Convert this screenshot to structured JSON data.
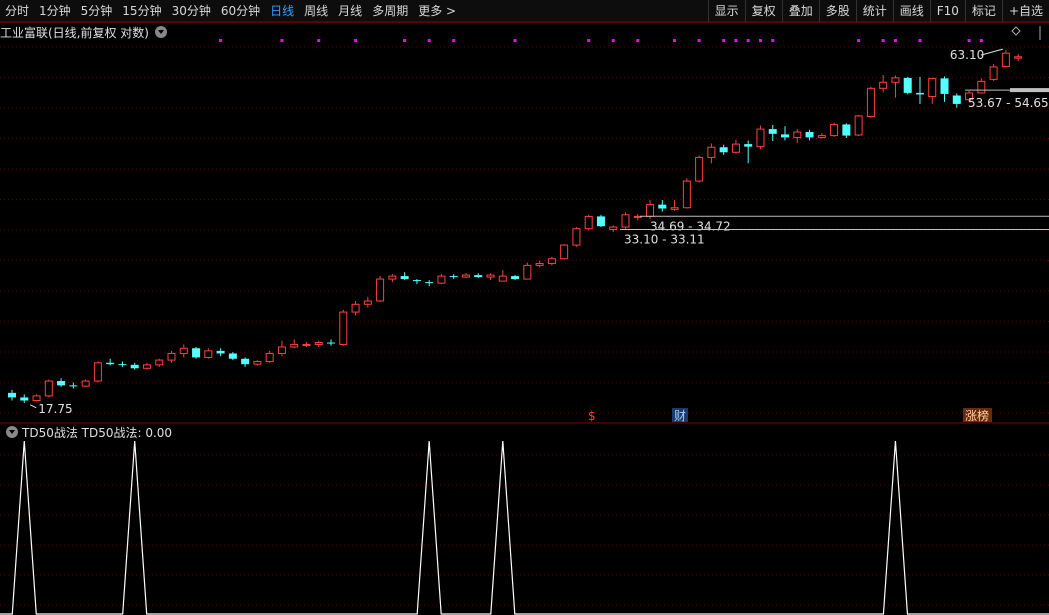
{
  "toolbar": {
    "periods": [
      {
        "label": "分时",
        "active": false
      },
      {
        "label": "1分钟",
        "active": false
      },
      {
        "label": "5分钟",
        "active": false
      },
      {
        "label": "15分钟",
        "active": false
      },
      {
        "label": "30分钟",
        "active": false
      },
      {
        "label": "60分钟",
        "active": false
      },
      {
        "label": "日线",
        "active": true
      },
      {
        "label": "周线",
        "active": false
      },
      {
        "label": "月线",
        "active": false
      },
      {
        "label": "多周期",
        "active": false
      },
      {
        "label": "更多 >",
        "active": false
      }
    ],
    "actions": [
      "显示",
      "复权",
      "叠加",
      "多股",
      "统计",
      "画线",
      "F10",
      "标记",
      "+自选"
    ]
  },
  "main_chart": {
    "title": "工业富联(日线,前复权 对数)",
    "high_label": "63.10",
    "low_label": "17.75",
    "range_labels": [
      "53.67 - 54.65",
      "34.69 - 34.72",
      "33.10 - 33.11"
    ],
    "event_markers": [
      "$",
      "财",
      "涨榜"
    ],
    "colors": {
      "up": "#ff4040",
      "down": "#54ffff",
      "grid": "#5a0000",
      "dot": "#ff00ff",
      "line": "#c0c0c0"
    }
  },
  "indicator": {
    "title": "TD50战法  TD50战法: 0.00"
  },
  "chart_data": [
    {
      "type": "candlestick",
      "title": "工业富联(日线,前复权 对数)",
      "scale": "log",
      "grid": "horizontal dotted",
      "ohlc": [
        [
          18.4,
          18.6,
          17.9,
          18.1
        ],
        [
          18.1,
          18.3,
          17.75,
          17.9
        ],
        [
          17.9,
          18.3,
          17.85,
          18.2
        ],
        [
          18.2,
          19.3,
          18.1,
          19.2
        ],
        [
          19.2,
          19.4,
          18.8,
          18.9
        ],
        [
          18.9,
          19.1,
          18.7,
          18.85
        ],
        [
          18.85,
          19.3,
          18.8,
          19.2
        ],
        [
          19.2,
          20.6,
          19.1,
          20.5
        ],
        [
          20.5,
          20.8,
          20.3,
          20.4
        ],
        [
          20.4,
          20.6,
          20.2,
          20.35
        ],
        [
          20.35,
          20.5,
          20.0,
          20.1
        ],
        [
          20.1,
          20.5,
          20.0,
          20.35
        ],
        [
          20.35,
          20.8,
          20.2,
          20.7
        ],
        [
          20.7,
          21.4,
          20.5,
          21.2
        ],
        [
          21.2,
          21.9,
          20.9,
          21.6
        ],
        [
          21.6,
          21.7,
          20.8,
          20.9
        ],
        [
          20.9,
          21.6,
          20.8,
          21.4
        ],
        [
          21.4,
          21.6,
          21.0,
          21.2
        ],
        [
          21.2,
          21.3,
          20.7,
          20.8
        ],
        [
          20.8,
          20.9,
          20.2,
          20.4
        ],
        [
          20.4,
          20.7,
          20.3,
          20.6
        ],
        [
          20.6,
          21.4,
          20.5,
          21.2
        ],
        [
          21.2,
          22.2,
          21.0,
          21.7
        ],
        [
          21.7,
          22.3,
          21.6,
          21.9
        ],
        [
          21.9,
          22.1,
          21.7,
          21.9
        ],
        [
          21.9,
          22.2,
          21.7,
          22.05
        ],
        [
          22.05,
          22.3,
          21.8,
          22.0
        ],
        [
          21.9,
          24.8,
          21.8,
          24.6
        ],
        [
          24.6,
          25.6,
          24.3,
          25.3
        ],
        [
          25.3,
          26.0,
          25.0,
          25.6
        ],
        [
          25.6,
          28.0,
          25.5,
          27.7
        ],
        [
          27.7,
          28.2,
          27.4,
          28.0
        ],
        [
          28.0,
          28.4,
          27.6,
          27.7
        ],
        [
          27.6,
          27.7,
          27.2,
          27.5
        ],
        [
          27.4,
          27.6,
          27.0,
          27.3
        ],
        [
          27.3,
          28.2,
          27.2,
          28.0
        ],
        [
          28.0,
          28.2,
          27.7,
          27.9
        ],
        [
          27.9,
          28.3,
          27.8,
          28.1
        ],
        [
          28.1,
          28.3,
          27.8,
          27.9
        ],
        [
          27.9,
          28.3,
          27.6,
          28.1
        ],
        [
          27.5,
          28.6,
          27.5,
          28.0
        ],
        [
          28.0,
          28.1,
          27.6,
          27.7
        ],
        [
          27.7,
          29.4,
          27.7,
          29.1
        ],
        [
          29.1,
          29.6,
          28.9,
          29.3
        ],
        [
          29.3,
          30.0,
          29.1,
          29.8
        ],
        [
          29.8,
          31.4,
          29.7,
          31.3
        ],
        [
          31.3,
          33.4,
          31.1,
          33.2
        ],
        [
          33.2,
          34.9,
          33.0,
          34.7
        ],
        [
          34.7,
          34.9,
          33.4,
          33.5
        ],
        [
          33.1,
          33.6,
          32.8,
          33.4
        ],
        [
          33.4,
          35.2,
          33.2,
          34.9
        ],
        [
          34.7,
          35.0,
          34.2,
          34.7
        ],
        [
          34.7,
          36.8,
          34.4,
          36.2
        ],
        [
          36.2,
          36.8,
          35.3,
          35.7
        ],
        [
          35.6,
          36.8,
          35.4,
          35.8
        ],
        [
          35.8,
          39.8,
          35.7,
          39.4
        ],
        [
          39.4,
          43.2,
          39.2,
          42.9
        ],
        [
          42.9,
          45.1,
          42.0,
          44.5
        ],
        [
          44.5,
          44.9,
          43.3,
          43.7
        ],
        [
          43.7,
          45.7,
          43.5,
          45.0
        ],
        [
          45.0,
          45.6,
          42.0,
          44.6
        ],
        [
          44.6,
          48.1,
          44.2,
          47.5
        ],
        [
          47.5,
          48.2,
          45.5,
          46.7
        ],
        [
          46.6,
          48.0,
          45.6,
          46.1
        ],
        [
          46.1,
          47.5,
          45.2,
          47.0
        ],
        [
          47.0,
          47.4,
          45.6,
          46.1
        ],
        [
          46.1,
          46.8,
          45.9,
          46.4
        ],
        [
          46.4,
          48.6,
          46.2,
          48.3
        ],
        [
          48.3,
          48.5,
          46.0,
          46.4
        ],
        [
          46.5,
          50.0,
          46.3,
          49.8
        ],
        [
          49.7,
          55.3,
          49.5,
          55.0
        ],
        [
          55.0,
          57.7,
          54.2,
          56.2
        ],
        [
          56.2,
          57.6,
          53.2,
          57.1
        ],
        [
          57.1,
          57.3,
          53.8,
          54.1
        ],
        [
          54.1,
          57.3,
          52.0,
          53.8
        ],
        [
          53.4,
          57.1,
          52.0,
          57.0
        ],
        [
          57.0,
          57.4,
          52.4,
          53.9
        ],
        [
          53.6,
          54.0,
          51.3,
          52.0
        ],
        [
          52.8,
          54.5,
          52.4,
          54.1
        ],
        [
          54.1,
          57.0,
          54.0,
          56.4
        ],
        [
          56.8,
          60.0,
          56.5,
          59.4
        ],
        [
          59.5,
          63.1,
          59.3,
          62.4
        ],
        [
          61.3,
          62.2,
          60.6,
          61.6
        ]
      ],
      "range_labels": [
        "53.67 - 54.65",
        "34.69 - 34.72",
        "33.10 - 33.11"
      ],
      "high": 63.1,
      "low": 17.75,
      "top_dots_index": [
        17,
        22,
        25,
        28,
        32,
        34,
        36,
        41,
        47,
        49,
        51,
        54,
        56,
        58,
        59,
        60,
        61,
        62,
        69,
        71,
        72,
        74,
        78,
        79
      ]
    },
    {
      "type": "line",
      "title": "TD50战法  TD50战法: 0.00",
      "series": [
        {
          "name": "TD50战法",
          "spikes_index": [
            1,
            10,
            34,
            40,
            72
          ]
        }
      ],
      "ylim": [
        0,
        1
      ]
    }
  ]
}
